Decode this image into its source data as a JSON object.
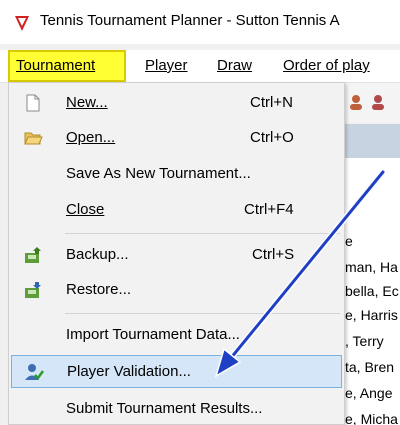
{
  "window": {
    "title": "Tennis Tournament Planner - Sutton Tennis A"
  },
  "menubar": {
    "items": [
      {
        "label": "Tournament",
        "active": true
      },
      {
        "label": "Player"
      },
      {
        "label": "Draw"
      },
      {
        "label": "Order of play"
      }
    ]
  },
  "dropdown": {
    "items": [
      {
        "label": "New...",
        "shortcut": "Ctrl+N",
        "icon": "new-document-icon"
      },
      {
        "label": "Open...",
        "shortcut": "Ctrl+O",
        "icon": "open-folder-icon"
      },
      {
        "label": "Save As New Tournament...",
        "shortcut": ""
      },
      {
        "label": "Close",
        "shortcut": "Ctrl+F4"
      },
      {
        "label": "Backup...",
        "shortcut": "Ctrl+S",
        "icon": "backup-icon"
      },
      {
        "label": "Restore...",
        "shortcut": "",
        "icon": "restore-icon"
      },
      {
        "label": "Import Tournament Data...",
        "shortcut": ""
      },
      {
        "label": "Player Validation...",
        "shortcut": "",
        "icon": "player-validation-icon",
        "highlighted": true
      },
      {
        "label": "Submit Tournament Results...",
        "shortcut": ""
      }
    ]
  },
  "background_list": {
    "rows": [
      "e",
      "man, Ha",
      "bella, Ec",
      "e, Harris",
      ", Terry",
      "ta, Bren",
      "e, Ange",
      "e, Micha"
    ]
  },
  "colors": {
    "active_menu": "#ffff33",
    "highlight": "#d4e6f7",
    "arrow": "#1f3fc4"
  }
}
